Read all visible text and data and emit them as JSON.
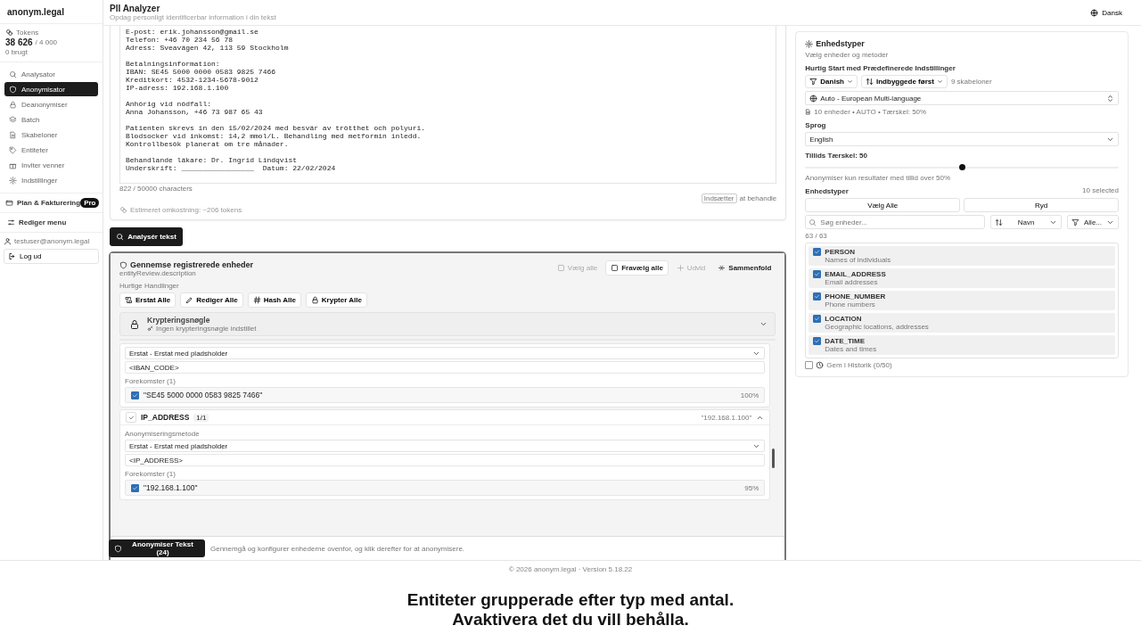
{
  "sidebar": {
    "logo": "anonym.legal",
    "tokens": {
      "label": "Tokens",
      "value": "38 626",
      "limit": "/ 4 000",
      "used": "0 brugt"
    },
    "nav": [
      {
        "label": "Analysator",
        "selected": false
      },
      {
        "label": "Anonymisator",
        "selected": true
      },
      {
        "label": "Deanonymiser",
        "selected": false
      },
      {
        "label": "Batch",
        "selected": false
      },
      {
        "label": "Skabeloner",
        "selected": false
      },
      {
        "label": "Entiteter",
        "selected": false
      },
      {
        "label": "Inviter venner",
        "selected": false
      },
      {
        "label": "Indstillinger",
        "selected": false
      }
    ],
    "plan": {
      "label": "Plan & Fakturering",
      "badge": "Pro"
    },
    "edit_menu": "Rediger menu",
    "user": "testuser@anonym.legal",
    "logout": "Log ud"
  },
  "header": {
    "title": "PII Analyzer",
    "subtitle": "Opdag personligt identificerbar information i din tekst",
    "language": "Dansk"
  },
  "editor": {
    "paragraphs": [
      [
        "E-post: erik.johansson@gmail.se",
        "Telefon: +46 70 234 56 78",
        "Adress: Sveavägen 42, 113 59 Stockholm"
      ],
      [
        "Betalningsinformation:",
        "IBAN: SE45 5000 0000 0583 9825 7466",
        "Kreditkort: 4532-1234-5678-9012",
        "IP-adress: 192.168.1.100"
      ],
      [
        "Anhörig vid nödfall:",
        "Anna Johansson, +46 73 987 65 43"
      ],
      [
        "Patienten skrevs in den 15/02/2024 med besvär av trötthet och polyuri.",
        "Blodsocker vid inkomst: 14,2 mmol/L. Behandling med metformin inledd.",
        "Kontrollbesök planerat om tre månader."
      ],
      [
        "Behandlande läkare: Dr. Ingrid Lindqvist",
        "Underskrift: _________________  Datum: 22/02/2024"
      ]
    ],
    "char_count": "822 / 50000 characters",
    "shortcut_key": "Indsætter",
    "shortcut_hint": "at behandle",
    "cost": "Estimeret omkostning: ~206 tokens"
  },
  "analyze_button": "Analysér tekst",
  "review": {
    "title": "Gennemse registrerede enheder",
    "description": "entityReview.description",
    "actions": [
      {
        "label": "Vælg alle",
        "disabled": true
      },
      {
        "label": "Fravælg alle",
        "disabled": false
      },
      {
        "label": "Udvid",
        "disabled": true
      },
      {
        "label": "Sammenfold",
        "disabled": false
      }
    ],
    "quick_label": "Hurtige Handlinger",
    "quick_actions": [
      "Erstat Alle",
      "Rediger Alle",
      "Hash Alle",
      "Krypter Alle"
    ],
    "encryption": {
      "title": "Krypteringsnøgle",
      "status": "Ingen krypteringsnøgle indstillet",
      "expanded": false
    },
    "groups": [
      {
        "method": "Erstat - Erstat med pladsholder",
        "placeholder_value": "<IBAN_CODE>",
        "occurrences_label": "Forekomster (1)",
        "occurrences": [
          {
            "text": "\"SE45 5000 0000 0583 9825 7466\"",
            "checked": true,
            "confidence": "100%"
          }
        ]
      },
      {
        "checked": true,
        "name": "IP_ADDRESS",
        "count": "1/1",
        "preview": "\"192.168.1.100\"",
        "expanded": true,
        "method_label": "Anonymiseringsmetode",
        "method": "Erstat - Erstat med pladsholder",
        "placeholder_value": "<IP_ADDRESS>",
        "occurrences_label": "Forekomster (1)",
        "occurrences": [
          {
            "text": "\"192.168.1.100\"",
            "checked": true,
            "confidence": "95%"
          }
        ]
      }
    ],
    "submit": "Anonymiser Tekst (24)",
    "hint": "Gennemgå og konfigurer enhederne ovenfor, og klik derefter for at anonymisere."
  },
  "settings": {
    "title": "Enhedstyper",
    "subtitle": "Vælg enheder og metoder",
    "quick_start": "Hurtig Start med Prædefinerede Indstillinger",
    "filters": [
      {
        "kind": "filter",
        "label": "Danish"
      },
      {
        "kind": "sort",
        "label": "Indbyggede først"
      }
    ],
    "template_count": "9 skabeloner",
    "preset": "Auto - European Multi-language",
    "preset_info": "10 enheder • AUTO • Tærskel: 50%",
    "language_label": "Sprog",
    "language": "English",
    "threshold": {
      "label": "Tillids Tærskel: 50",
      "level": 0.5,
      "hint": "Anonymiser kun resultater med tillid over 50%"
    },
    "entities_label": "Enhedstyper",
    "selected_count": "10 selected",
    "select_all": "Vælg Alle",
    "clear": "Ryd",
    "search_placeholder": "Søg enheder...",
    "sort": "Navn",
    "filter": "Alle...",
    "shown_count": "63 / 63",
    "entities": [
      {
        "name": "PERSON",
        "description": "Names of individuals",
        "checked": true
      },
      {
        "name": "EMAIL_ADDRESS",
        "description": "Email addresses",
        "checked": true
      },
      {
        "name": "PHONE_NUMBER",
        "description": "Phone numbers",
        "checked": true
      },
      {
        "name": "LOCATION",
        "description": "Geographic locations, addresses",
        "checked": true
      },
      {
        "name": "DATE_TIME",
        "description": "Dates and times",
        "checked": true
      }
    ],
    "save_history": {
      "label": "Gem i Historik (0/50)",
      "checked": false
    }
  },
  "footer": "© 2026 anonym.legal · Version 5.18.22",
  "caption": [
    "Entiteter grupperade efter typ med antal.",
    "Avaktivera det du vill behålla."
  ]
}
